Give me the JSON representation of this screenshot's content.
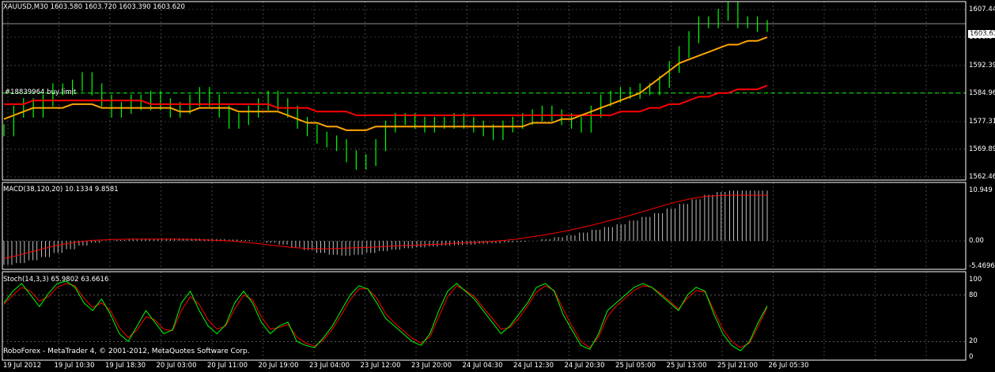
{
  "header": {
    "symbol": "XAUUSD,M30",
    "ohlc": "1603.580 1603.720 1603.390 1603.620"
  },
  "order_line_label": "#18839964 buy limit",
  "copyright": "RoboForex - MetaTrader 4, © 2001-2012, MetaQuotes Software Corp.",
  "current_price_label": "1603.62",
  "price_axis_labels": [
    "1607.44",
    "1600.04",
    "1592.39",
    "1584.96",
    "1577.31",
    "1569.89",
    "1562.46"
  ],
  "macd_header": "MACD(38,120,20) 10.1334 9.8581",
  "macd_axis_labels": [
    "10.949",
    "0.00",
    "-5.4696"
  ],
  "stoch_header": "Stoch(14,3,3) 65.9802 63.6616",
  "stoch_axis_labels": [
    "100",
    "80",
    "20",
    "0"
  ],
  "time_labels": [
    "19 Jul 2012",
    "19 Jul 10:30",
    "19 Jul 18:30",
    "20 Jul 03:00",
    "20 Jul 11:00",
    "20 Jul 19:00",
    "23 Jul 04:00",
    "23 Jul 12:00",
    "23 Jul 20:00",
    "24 Jul 04:30",
    "24 Jul 12:30",
    "24 Jul 20:30",
    "25 Jul 05:00",
    "25 Jul 13:00",
    "25 Jul 21:00",
    "26 Jul 05:30"
  ],
  "colors": {
    "background": "#000000",
    "grid": "#c8c8c8",
    "candles": "#00ff00",
    "ma_fast": "#ffa500",
    "ma_slow": "#ff0000",
    "signal": "#ff0000",
    "macd_hist": "#c0c0c0",
    "stoch_main": "#00ff00",
    "order_line": "#00ff00"
  },
  "chart_data": [
    {
      "type": "line",
      "title": "XAUUSD,M30",
      "ylim": [
        1562.46,
        1607.44
      ],
      "order_level": 1585.0,
      "current_price": 1603.62,
      "series": [
        {
          "name": "price",
          "values": [
            1575,
            1580,
            1582,
            1580,
            1583,
            1586,
            1586,
            1587,
            1589,
            1586,
            1583,
            1580,
            1581,
            1583,
            1582,
            1584,
            1582,
            1580,
            1581,
            1583,
            1585,
            1583,
            1580,
            1577,
            1578,
            1580,
            1582,
            1584,
            1582,
            1580,
            1577,
            1575,
            1573,
            1572,
            1571,
            1568,
            1566,
            1567,
            1571,
            1576,
            1578,
            1578,
            1577,
            1576,
            1577,
            1577,
            1578,
            1577,
            1576,
            1575,
            1574,
            1576,
            1577,
            1578,
            1579,
            1580,
            1579,
            1578,
            1577,
            1576,
            1580,
            1583,
            1584,
            1585,
            1585,
            1586,
            1586,
            1588,
            1592,
            1596,
            1600,
            1604,
            1604,
            1606,
            1608,
            1604,
            1604,
            1603,
            1603
          ]
        },
        {
          "name": "",
          "values": [
            1578,
            1579,
            1580,
            1581,
            1581,
            1581,
            1581,
            1582,
            1582,
            1582,
            1581,
            1581,
            1581,
            1581,
            1581,
            1581,
            1581,
            1581,
            1580,
            1580,
            1581,
            1581,
            1581,
            1581,
            1580,
            1580,
            1580,
            1580,
            1580,
            1579,
            1578,
            1577,
            1577,
            1576,
            1576,
            1575,
            1575,
            1575,
            1576,
            1576,
            1576,
            1576,
            1576,
            1576,
            1576,
            1576,
            1576,
            1576,
            1576,
            1576,
            1576,
            1576,
            1576,
            1576,
            1577,
            1577,
            1577,
            1578,
            1578,
            1579,
            1580,
            1581,
            1582,
            1583,
            1584,
            1585,
            1587,
            1589,
            1591,
            1593,
            1594,
            1595,
            1596,
            1597,
            1598,
            1598,
            1599,
            1599,
            1600
          ]
        },
        {
          "name": "",
          "values": [
            1582,
            1582,
            1582,
            1583,
            1583,
            1583,
            1583,
            1583,
            1583,
            1583,
            1583,
            1583,
            1583,
            1583,
            1583,
            1582,
            1582,
            1582,
            1582,
            1582,
            1582,
            1582,
            1582,
            1582,
            1582,
            1582,
            1582,
            1582,
            1581,
            1581,
            1581,
            1581,
            1580,
            1580,
            1580,
            1580,
            1579,
            1579,
            1579,
            1579,
            1579,
            1579,
            1579,
            1579,
            1579,
            1579,
            1579,
            1579,
            1579,
            1579,
            1579,
            1579,
            1579,
            1579,
            1579,
            1579,
            1579,
            1579,
            1579,
            1579,
            1579,
            1579,
            1579,
            1580,
            1580,
            1580,
            1581,
            1581,
            1582,
            1582,
            1583,
            1584,
            1584,
            1585,
            1585,
            1586,
            1586,
            1586,
            1587
          ]
        }
      ]
    },
    {
      "type": "bar",
      "title": "MACD(38,120,20) 10.1334 9.8581",
      "ylim": [
        -5.4696,
        10.949
      ],
      "series": [
        {
          "name": "",
          "values": [
            -5.2,
            -4.8,
            -4.2,
            -3.5,
            -2.6,
            -1.8,
            -1.0,
            -0.4,
            0.0,
            0.2,
            0.4,
            0.5,
            0.5,
            0.5,
            0.5,
            0.5,
            0.4,
            0.4,
            0.3,
            0.2,
            0.0,
            -0.4,
            -0.8,
            -1.4,
            -2.0,
            -2.6,
            -3.0,
            -3.2,
            -3.0,
            -2.6,
            -2.2,
            -1.9,
            -1.6,
            -1.4,
            -1.2,
            -1.0,
            -0.9,
            -0.8,
            -0.6,
            -0.5,
            -0.3,
            -0.2,
            0.0,
            0.4,
            0.8,
            1.2,
            1.8,
            2.4,
            3.0,
            3.6,
            4.4,
            5.2,
            6.0,
            7.0,
            8.0,
            9.0,
            10.0,
            10.6,
            10.9,
            10.9,
            10.9,
            10.9
          ]
        },
        {
          "name": "",
          "values": [
            -3.8,
            -3.2,
            -2.5,
            -1.8,
            -1.1,
            -0.6,
            -0.2,
            0.1,
            0.2,
            0.3,
            0.4,
            0.4,
            0.4,
            0.4,
            0.4,
            0.3,
            0.2,
            0.1,
            0.0,
            -0.2,
            -0.5,
            -0.8,
            -1.1,
            -1.4,
            -1.6,
            -1.7,
            -1.7,
            -1.6,
            -1.5,
            -1.4,
            -1.3,
            -1.1,
            -1.0,
            -0.9,
            -0.8,
            -0.7,
            -0.5,
            -0.4,
            -0.3,
            -0.1,
            0.1,
            0.4,
            0.8,
            1.2,
            1.7,
            2.2,
            2.8,
            3.4,
            4.1,
            4.8,
            5.5,
            6.3,
            7.1,
            7.9,
            8.6,
            9.2,
            9.6,
            9.8,
            9.9,
            9.9,
            9.9,
            9.9
          ]
        }
      ]
    },
    {
      "type": "line",
      "title": "Stoch(14,3,3) 65.9802 63.6616",
      "ylim": [
        0,
        100
      ],
      "levels": [
        20,
        80
      ],
      "series": [
        {
          "name": "",
          "values": [
            70,
            85,
            95,
            80,
            65,
            82,
            95,
            98,
            90,
            70,
            60,
            75,
            55,
            30,
            20,
            40,
            60,
            45,
            30,
            35,
            70,
            85,
            60,
            40,
            30,
            42,
            70,
            85,
            70,
            45,
            30,
            40,
            45,
            20,
            15,
            12,
            25,
            40,
            60,
            80,
            92,
            88,
            70,
            50,
            40,
            30,
            20,
            15,
            30,
            60,
            85,
            95,
            85,
            75,
            60,
            45,
            30,
            40,
            55,
            70,
            90,
            95,
            85,
            55,
            35,
            15,
            10,
            30,
            60,
            70,
            80,
            90,
            95,
            90,
            80,
            70,
            60,
            80,
            90,
            85,
            55,
            30,
            15,
            8,
            20,
            45,
            66
          ]
        },
        {
          "name": "",
          "values": [
            68,
            80,
            90,
            85,
            72,
            78,
            90,
            95,
            92,
            76,
            64,
            70,
            60,
            38,
            25,
            35,
            52,
            48,
            36,
            34,
            60,
            78,
            68,
            48,
            36,
            40,
            62,
            80,
            74,
            52,
            36,
            38,
            42,
            26,
            18,
            14,
            22,
            36,
            54,
            74,
            88,
            88,
            76,
            56,
            44,
            34,
            24,
            18,
            26,
            52,
            78,
            92,
            86,
            78,
            64,
            50,
            36,
            38,
            50,
            66,
            84,
            92,
            86,
            62,
            40,
            20,
            12,
            26,
            52,
            66,
            76,
            86,
            92,
            90,
            82,
            72,
            62,
            76,
            86,
            84,
            60,
            36,
            20,
            12,
            18,
            40,
            64
          ]
        }
      ]
    }
  ]
}
